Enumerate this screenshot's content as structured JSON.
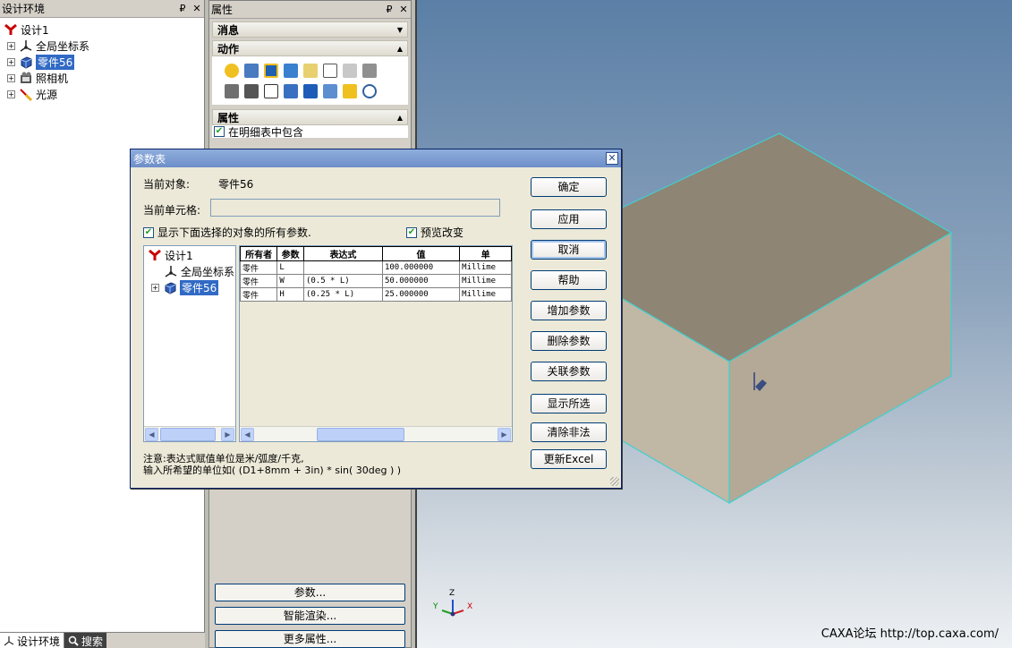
{
  "tree_panel": {
    "title": "设计环境",
    "pin": "₽",
    "close": "✕",
    "items": [
      {
        "label": "设计1"
      },
      {
        "label": "全局坐标系"
      },
      {
        "label": "零件56"
      },
      {
        "label": "照相机"
      },
      {
        "label": "光源"
      }
    ],
    "tabs": [
      {
        "label": "设计环境"
      },
      {
        "label": "搜索"
      }
    ]
  },
  "prop_panel": {
    "title": "属性",
    "pin": "₽",
    "close": "✕",
    "sections": {
      "message": "消息",
      "actions": "动作",
      "properties": "属性"
    },
    "include_in_bom": "在明细表中包含",
    "buttons": [
      "参数...",
      "智能渲染...",
      "更多属性..."
    ]
  },
  "dialog": {
    "title": "参数表",
    "close": "✕",
    "current_object_label": "当前对象:",
    "current_object_value": "零件56",
    "current_cell_label": "当前单元格:",
    "show_all_label": "显示下面选择的对象的所有参数.",
    "preview_label": "预览改变",
    "tree": [
      {
        "label": "设计1"
      },
      {
        "label": "全局坐标系"
      },
      {
        "label": "零件56"
      }
    ],
    "table": {
      "headers": [
        "所有者",
        "参数",
        "表达式",
        "值",
        "单"
      ],
      "rows": [
        [
          "零件",
          "L",
          "",
          "100.000000",
          "Millime"
        ],
        [
          "零件",
          "W",
          "(0.5 * L)",
          "50.000000",
          "Millime"
        ],
        [
          "零件",
          "H",
          "(0.25 * L)",
          "25.000000",
          "Millime"
        ]
      ]
    },
    "buttons": [
      "确定",
      "应用",
      "取消",
      "帮助",
      "增加参数",
      "删除参数",
      "关联参数",
      "显示所选",
      "清除非法",
      "更新Excel"
    ],
    "note_line1": "注意:表达式赋值单位是米/弧度/千克,",
    "note_line2": "输入所希望的单位如( (D1+8mm + 3in) * sin( 30deg ) )"
  },
  "viewport": {
    "axis_x": "X",
    "axis_y": "Y",
    "axis_z": "Z",
    "watermark": "CAXA论坛 http://top.caxa.com/"
  }
}
